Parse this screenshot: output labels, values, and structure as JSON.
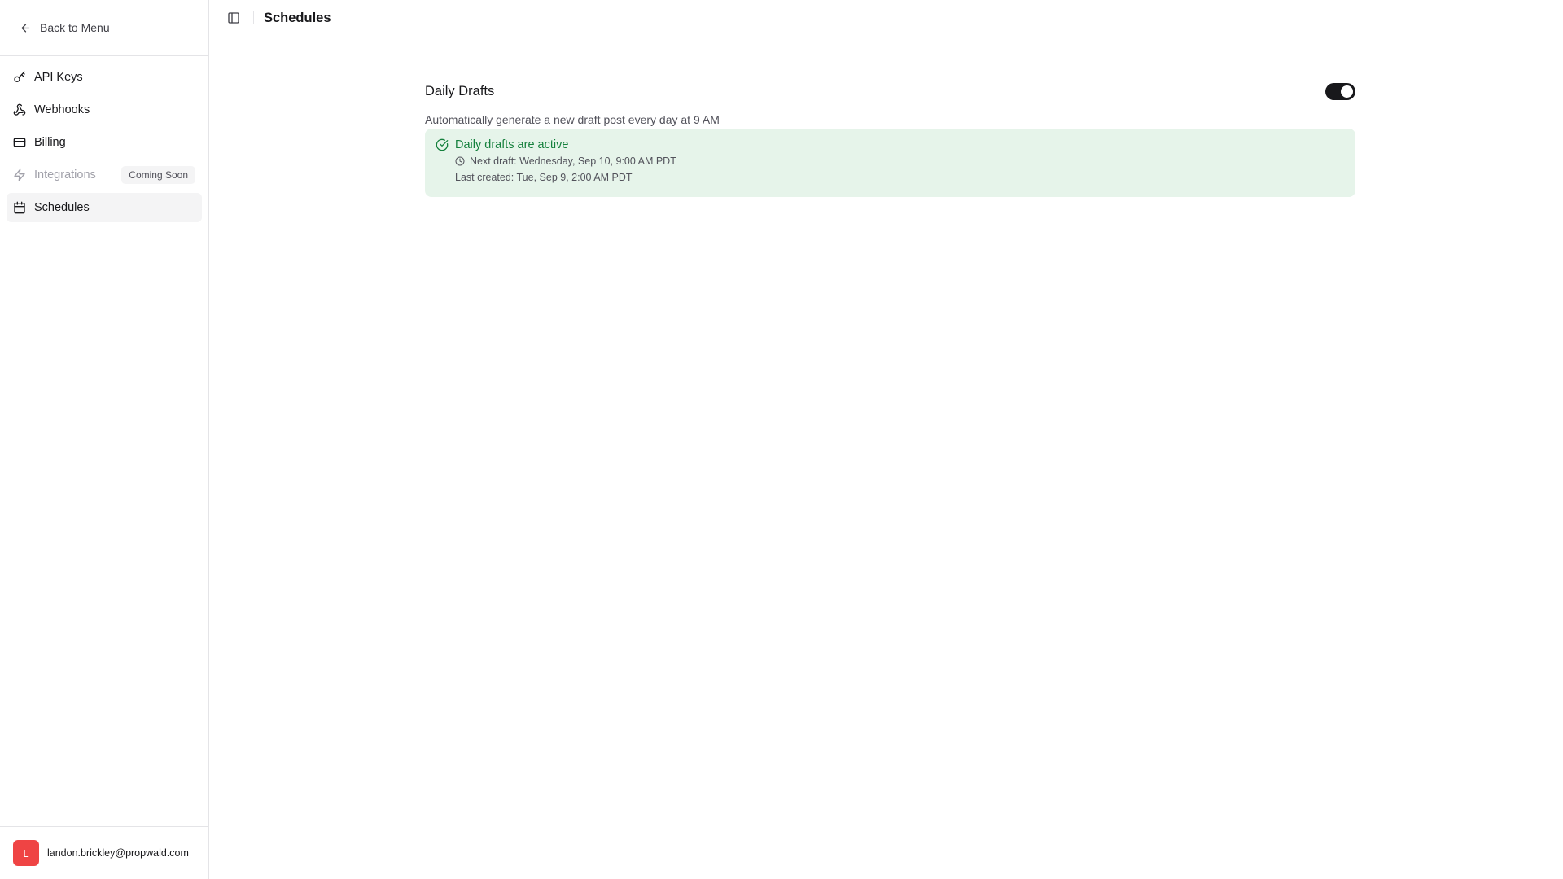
{
  "sidebar": {
    "back_label": "Back to Menu",
    "items": [
      {
        "label": "API Keys",
        "icon": "key-icon"
      },
      {
        "label": "Webhooks",
        "icon": "webhook-icon"
      },
      {
        "label": "Billing",
        "icon": "credit-card-icon"
      },
      {
        "label": "Integrations",
        "icon": "zap-icon",
        "badge": "Coming Soon",
        "disabled": true
      },
      {
        "label": "Schedules",
        "icon": "calendar-icon",
        "active": true
      }
    ],
    "user": {
      "avatar_initial": "L",
      "avatar_color": "#ef4444",
      "email": "landon.brickley@propwald.com"
    }
  },
  "header": {
    "title": "Schedules"
  },
  "daily_drafts": {
    "title": "Daily Drafts",
    "enabled": true,
    "description": "Automatically generate a new draft post every day at 9 AM",
    "status": {
      "title": "Daily drafts are active",
      "next_draft": "Next draft: Wednesday, Sep 10, 9:00 AM PDT",
      "last_created": "Last created: Tue, Sep 9, 2:00 AM PDT",
      "accent_color": "#15803d",
      "background_color": "#e6f4ea"
    }
  }
}
